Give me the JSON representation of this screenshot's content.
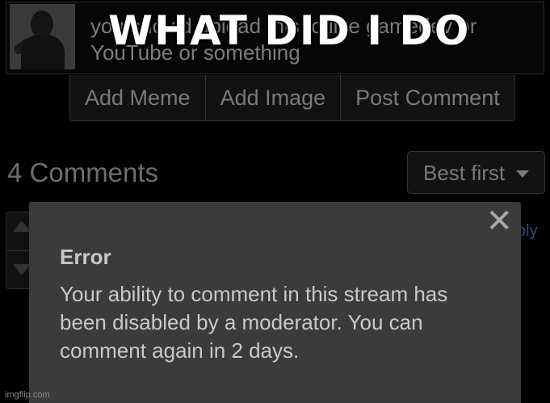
{
  "composer": {
    "comment_text": "you should upload this to like gamedev or YouTube or something",
    "meme_caption": "WHAT DID I DO"
  },
  "actions": {
    "add_meme": "Add Meme",
    "add_image": "Add Image",
    "post_comment": "Post Comment"
  },
  "comments": {
    "count_label": "4 Comments",
    "sort_label": "Best first",
    "reply_label": "ply"
  },
  "error_modal": {
    "title": "Error",
    "message": "Your ability to comment in this stream has been disabled by a moderator. You can comment again in 2 days.",
    "close_glyph": "✕"
  },
  "watermark": "imgflip.com",
  "colors": {
    "background": "#000000",
    "modal_bg": "#3b3b3b",
    "modal_text": "#c9c9c9",
    "button_text": "#7a7a7a"
  },
  "icons": [
    "close-icon",
    "chevron-down-icon",
    "upvote-icon",
    "downvote-icon"
  ]
}
